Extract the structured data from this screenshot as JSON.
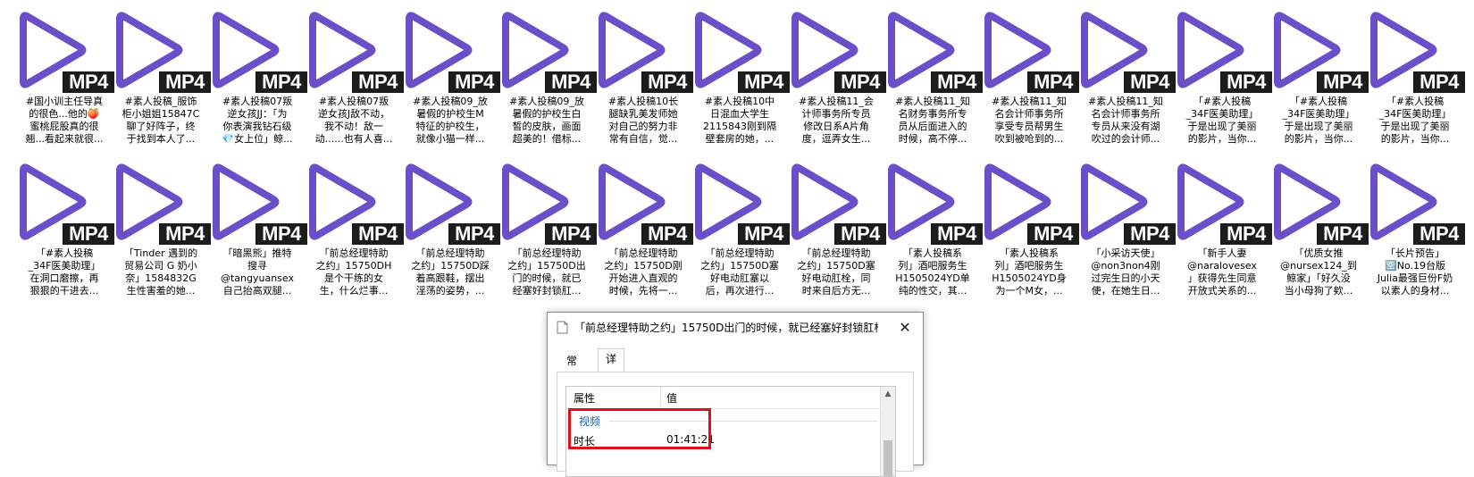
{
  "file_type_badge": "MP4",
  "icon_color": "#6a4fc9",
  "files_row1": [
    "#国小训主任导真\n的很色...他的🍑\n蜜桃屁股真的很\n翘...看起来就很...",
    "#素人投稿_服饰\n柜小姐姐15847C\n聊了好阵子，终\n于找到本人了...",
    "#素人投稿07叛\n逆女孩JJ：「为\n你表演我钻石级\n💎女上位」鲸...",
    "#素人投稿07叛\n逆女孩J敌不动，\n我不动！敌一\n动......也有人喜...",
    "#素人投稿09_放\n暑假的护校生M\n特征的护校生，\n就像小猫一样...",
    "#素人投稿09_放\n暑假的护校生白\n皙的皮肤，画面\n超美的！借标...",
    "#素人投稿10长\n腿缺乳美发师她\n对自己的努力非\n常有自信，觉...",
    "#素人投稿10中\n日混血大学生\n2115843刚到隔\n壁套房的她，...",
    "#素人投稿11_会\n计师事务所专员\n修改日系A片角\n度，逗弄女生...",
    "#素人投稿11_知\n名财务事务所专\n员从后面进入的\n时候，高不停...",
    "#素人投稿11_知\n名会计师事务所\n享受专员帮男生\n吹到被呛到的...",
    "#素人投稿11_知\n名会计师事务所\n专员从来没有湖\n吹过的会计师...",
    "「#素人投稿\n_34F医美助理」\n于是出现了美丽\n的影片，当你...",
    "「#素人投稿\n_34F医美助理」\n于是出现了美丽\n的影片，当你...",
    "「#素人投稿\n_34F医美助理」\n于是出现了美丽\n的影片，当你..."
  ],
  "files_row2": [
    "「#素人投稿\n_34F医美助理」\n在洞口磨擦，再\n狠狠的干进去...",
    "「Tinder 遇到的\n贸易公司 G 奶小\n奈」1584832G\n生性害羞的她...",
    "「暗黑熊」推特\n搜寻\n@tangyuansex\n自己抬高双腿...",
    "「前总经理特助\n之约」15750DH\n是个干练的女\n生，什么烂事...",
    "「前总经理特助\n之约」15750D踩\n着高跟鞋，摆出\n淫荡的姿势，...",
    "「前总经理特助\n之约」15750D出\n门的时候，就已\n经塞好封锁肛...",
    "「前总经理特助\n之约」15750D刚\n开始进入直观的\n时候，先将一...",
    "「前总经理特助\n之约」15750D塞\n好电动肛塞以\n后，再次进行...",
    "「前总经理特助\n之约」15750D塞\n好电动肛栓，同\n时来自后方无...",
    "「素人投稿系\n列」酒吧服务生\nH1505024YD单\n纯的性交，其...",
    "「素人投稿系\n列」酒吧服务生\nH1505024YD身\n为一个M女，...",
    "「小采访天使」\n@non3non4刚\n过完生日的小天\n使，在她生日...",
    "「新手人妻\n@naralovesex\n」获得先生同意\n开放式关系的...",
    "「优质女推\n@nursex124_到\n鲸家」「好久没\n当小母狗了欸...",
    "「长片预告」\n🈳No.19台版\nJulia最强巨份F奶\n以素人的身材..."
  ],
  "dialog": {
    "title": "「前总经理特助之约」15750D出门的时候，就已经塞好封锁肛栓...",
    "tabs": [
      "常规",
      "详细信息"
    ],
    "active_tab": "详细信息",
    "columns": [
      "属性",
      "值"
    ],
    "section": "视频",
    "rows": [
      {
        "name": "时长",
        "value": "01:41:21"
      }
    ],
    "highlight_color": "#e0101a"
  }
}
